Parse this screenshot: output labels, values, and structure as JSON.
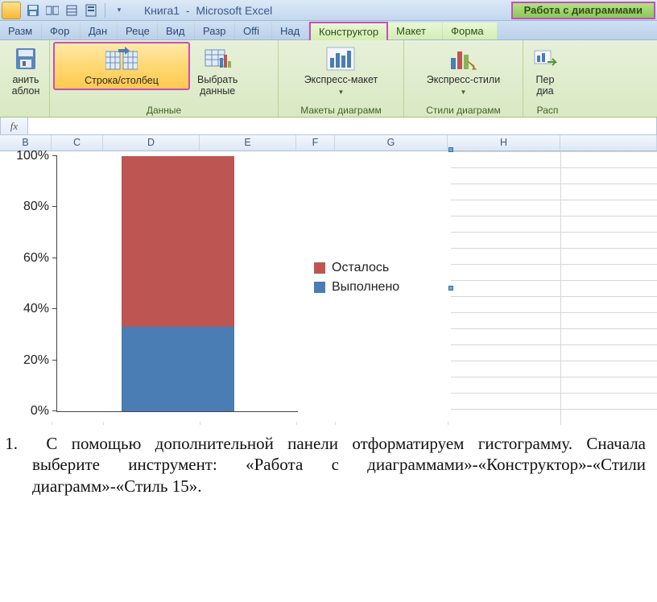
{
  "title": {
    "workbook": "Книга1",
    "app": "Microsoft Excel",
    "contextual": "Работа с диаграммами"
  },
  "tabs": [
    "Разм",
    "Фор",
    "Дан",
    "Реце",
    "Вид",
    "Разр",
    "Offi",
    "Над"
  ],
  "context_tabs": [
    "Конструктор",
    "Макет",
    "Форма"
  ],
  "ribbon": {
    "save_template": {
      "line1": "анить",
      "line2": "аблон"
    },
    "switch": "Строка/столбец",
    "select_data": {
      "line1": "Выбрать",
      "line2": "данные"
    },
    "express_layout": "Экспресс-макет",
    "express_styles": "Экспресс-стили",
    "move_chart": {
      "line1": "Пер",
      "line2": "диа"
    },
    "groups": {
      "data": "Данные",
      "layouts": "Макеты диаграмм",
      "styles": "Стили диаграмм",
      "loc": "Расп"
    }
  },
  "formula_bar": {
    "fx": "fx",
    "value": ""
  },
  "columns": [
    {
      "label": "B",
      "w": 64
    },
    {
      "label": "C",
      "w": 64
    },
    {
      "label": "D",
      "w": 120
    },
    {
      "label": "E",
      "w": 120
    },
    {
      "label": "F",
      "w": 48
    },
    {
      "label": "G",
      "w": 140
    },
    {
      "label": "H",
      "w": 140
    },
    {
      "label": "",
      "w": 120
    }
  ],
  "chart_data": {
    "type": "bar",
    "stacked": true,
    "orientation": "vertical",
    "categories": [
      ""
    ],
    "series": [
      {
        "name": "Выполнено",
        "values": [
          33
        ],
        "color": "#4a7db3"
      },
      {
        "name": "Осталось",
        "values": [
          67
        ],
        "color": "#bd5652"
      }
    ],
    "ylabel": "",
    "xlabel": "",
    "ylim": [
      0,
      100
    ],
    "y_ticks": [
      "0%",
      "20%",
      "40%",
      "60%",
      "80%",
      "100%"
    ],
    "legend_position": "right"
  },
  "doc": {
    "list_num": "1.",
    "text": "С помощью дополнительной панели отформатируем гистограмму. Сначала выберите инструмент: «Работа с диаграммами»-«Конструктор»-«Стили диаграмм»-«Стиль 15»."
  }
}
